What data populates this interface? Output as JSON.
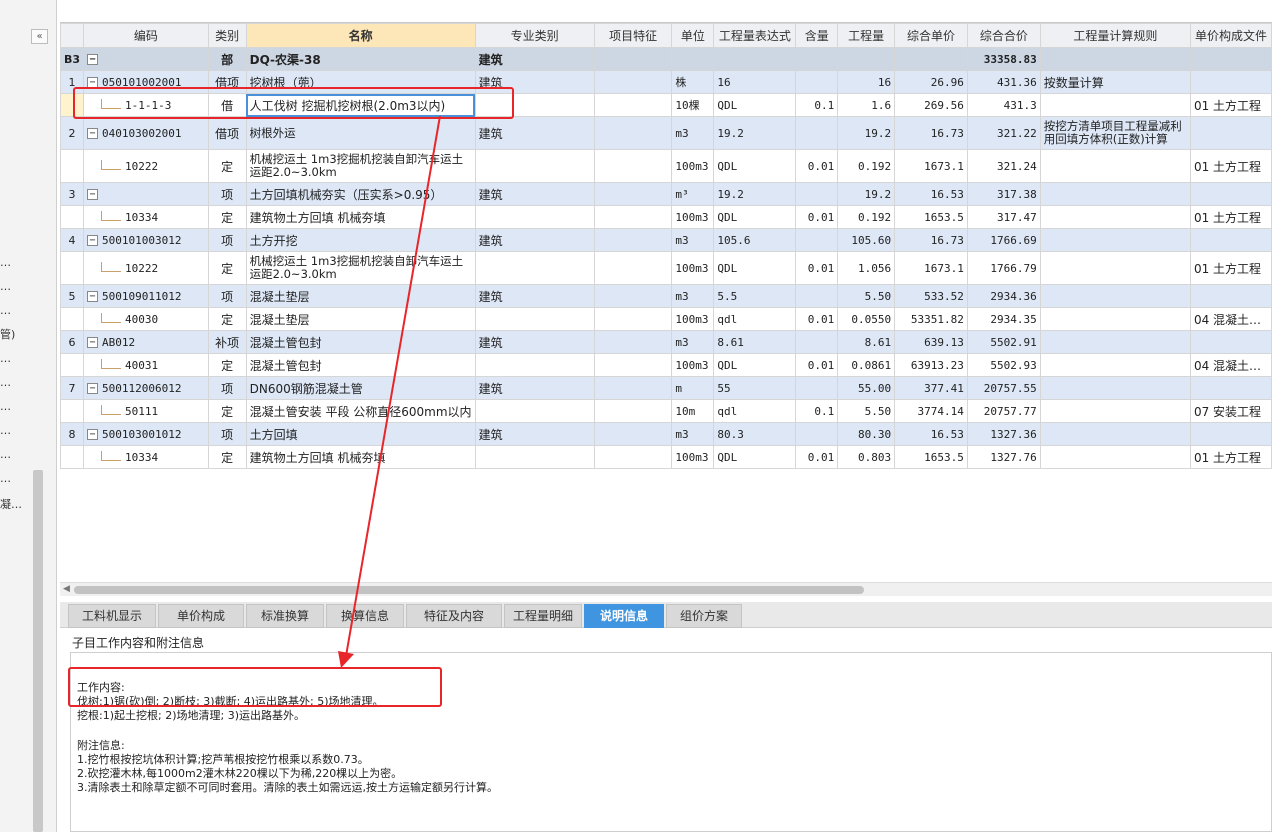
{
  "left_panel": {
    "collapse_label": "«",
    "items": [
      "…",
      "…",
      "…",
      "管)",
      "…",
      "…",
      "…",
      "…",
      "…",
      "…",
      "凝…"
    ]
  },
  "columns": [
    "",
    "编码",
    "类别",
    "名称",
    "专业类别",
    "项目特征",
    "单位",
    "工程量表达式",
    "含量",
    "工程量",
    "综合单价",
    "综合合价",
    "工程量计算规则",
    "单价构成文件"
  ],
  "rows": [
    {
      "type": "section",
      "no": "B3",
      "expand": "−",
      "code": "",
      "cat": "部",
      "name": "DQ-农渠-38",
      "major": "建筑",
      "feature": "",
      "unit": "",
      "expr": "",
      "content": "",
      "qty": "",
      "price": "",
      "total": "33358.83",
      "rule": "",
      "file": ""
    },
    {
      "type": "item",
      "no": "1",
      "expand": "−",
      "code": "050101002001",
      "cat": "借项",
      "name": "挖树根（蔸）",
      "major": "建筑",
      "feature": "",
      "unit": "株",
      "expr": "16",
      "content": "",
      "qty": "16",
      "price": "26.96",
      "total": "431.36",
      "rule": "按数量计算",
      "file": ""
    },
    {
      "type": "quota",
      "no": "",
      "code": "1-1-1-3",
      "cat": "借",
      "name": "人工伐树 挖掘机挖树根(2.0m3以内)",
      "major": "",
      "feature": "",
      "unit": "10棵",
      "expr": "QDL",
      "content": "0.1",
      "qty": "1.6",
      "price": "269.56",
      "total": "431.3",
      "rule": "",
      "file": "01 土方工程",
      "selected": true
    },
    {
      "type": "item",
      "no": "2",
      "expand": "−",
      "code": "040103002001",
      "cat": "借项",
      "name": "树根外运",
      "major": "建筑",
      "feature": "",
      "unit": "m3",
      "expr": "19.2",
      "content": "",
      "qty": "19.2",
      "price": "16.73",
      "total": "321.22",
      "rule": "按挖方清单项目工程量减利用回填方体积(正数)计算",
      "file": "",
      "tall": true
    },
    {
      "type": "quota",
      "no": "",
      "code": "10222",
      "cat": "定",
      "name": "机械挖运土 1m3挖掘机挖装自卸汽车运土 运距2.0~3.0km",
      "major": "",
      "feature": "",
      "unit": "100m3",
      "expr": "QDL",
      "content": "0.01",
      "qty": "0.192",
      "price": "1673.1",
      "total": "321.24",
      "rule": "",
      "file": "01 土方工程",
      "tall": true
    },
    {
      "type": "item",
      "no": "3",
      "expand": "−",
      "code": "",
      "cat": "项",
      "name": "土方回填机械夯实（压实系>0.95）",
      "major": "建筑",
      "feature": "",
      "unit": "m³",
      "expr": "19.2",
      "content": "",
      "qty": "19.2",
      "price": "16.53",
      "total": "317.38",
      "rule": "",
      "file": ""
    },
    {
      "type": "quota",
      "no": "",
      "code": "10334",
      "cat": "定",
      "name": "建筑物土方回填 机械夯填",
      "major": "",
      "feature": "",
      "unit": "100m3",
      "expr": "QDL",
      "content": "0.01",
      "qty": "0.192",
      "price": "1653.5",
      "total": "317.47",
      "rule": "",
      "file": "01 土方工程"
    },
    {
      "type": "item",
      "no": "4",
      "expand": "−",
      "code": "500101003012",
      "cat": "项",
      "name": "土方开挖",
      "major": "建筑",
      "feature": "",
      "unit": "m3",
      "expr": "105.6",
      "content": "",
      "qty": "105.60",
      "price": "16.73",
      "total": "1766.69",
      "rule": "",
      "file": ""
    },
    {
      "type": "quota",
      "no": "",
      "code": "10222",
      "cat": "定",
      "name": "机械挖运土 1m3挖掘机挖装自卸汽车运土 运距2.0~3.0km",
      "major": "",
      "feature": "",
      "unit": "100m3",
      "expr": "QDL",
      "content": "0.01",
      "qty": "1.056",
      "price": "1673.1",
      "total": "1766.79",
      "rule": "",
      "file": "01 土方工程",
      "tall": true
    },
    {
      "type": "item",
      "no": "5",
      "expand": "−",
      "code": "500109011012",
      "cat": "项",
      "name": "混凝土垫层",
      "major": "建筑",
      "feature": "",
      "unit": "m3",
      "expr": "5.5",
      "content": "",
      "qty": "5.50",
      "price": "533.52",
      "total": "2934.36",
      "rule": "",
      "file": ""
    },
    {
      "type": "quota",
      "no": "",
      "code": "40030",
      "cat": "定",
      "name": "混凝土垫层",
      "major": "",
      "feature": "",
      "unit": "100m3",
      "expr": "qdl",
      "content": "0.01",
      "qty": "0.0550",
      "price": "53351.82",
      "total": "2934.35",
      "rule": "",
      "file": "04 混凝土…"
    },
    {
      "type": "item",
      "no": "6",
      "expand": "−",
      "code": "AB012",
      "cat": "补项",
      "name": "混凝土管包封",
      "major": "建筑",
      "feature": "",
      "unit": "m3",
      "expr": "8.61",
      "content": "",
      "qty": "8.61",
      "price": "639.13",
      "total": "5502.91",
      "rule": "",
      "file": ""
    },
    {
      "type": "quota",
      "no": "",
      "code": "40031",
      "cat": "定",
      "name": "混凝土管包封",
      "major": "",
      "feature": "",
      "unit": "100m3",
      "expr": "QDL",
      "content": "0.01",
      "qty": "0.0861",
      "price": "63913.23",
      "total": "5502.93",
      "rule": "",
      "file": "04 混凝土…"
    },
    {
      "type": "item",
      "no": "7",
      "expand": "−",
      "code": "500112006012",
      "cat": "项",
      "name": "DN600钢筋混凝土管",
      "major": "建筑",
      "feature": "",
      "unit": "m",
      "expr": "55",
      "content": "",
      "qty": "55.00",
      "price": "377.41",
      "total": "20757.55",
      "rule": "",
      "file": ""
    },
    {
      "type": "quota",
      "no": "",
      "code": "50111",
      "cat": "定",
      "name": "混凝土管安装 平段 公称直径600mm以内",
      "major": "",
      "feature": "",
      "unit": "10m",
      "expr": "qdl",
      "content": "0.1",
      "qty": "5.50",
      "price": "3774.14",
      "total": "20757.77",
      "rule": "",
      "file": "07 安装工程"
    },
    {
      "type": "item",
      "no": "8",
      "expand": "−",
      "code": "500103001012",
      "cat": "项",
      "name": "土方回填",
      "major": "建筑",
      "feature": "",
      "unit": "m3",
      "expr": "80.3",
      "content": "",
      "qty": "80.30",
      "price": "16.53",
      "total": "1327.36",
      "rule": "",
      "file": ""
    },
    {
      "type": "quota",
      "no": "",
      "code": "10334",
      "cat": "定",
      "name": "建筑物土方回填 机械夯填",
      "major": "",
      "feature": "",
      "unit": "100m3",
      "expr": "QDL",
      "content": "0.01",
      "qty": "0.803",
      "price": "1653.5",
      "total": "1327.76",
      "rule": "",
      "file": "01 土方工程"
    }
  ],
  "tabs": [
    {
      "label": "工料机显示",
      "active": false
    },
    {
      "label": "单价构成",
      "active": false
    },
    {
      "label": "标准换算",
      "active": false
    },
    {
      "label": "换算信息",
      "active": false
    },
    {
      "label": "特征及内容",
      "active": false
    },
    {
      "label": "工程量明细",
      "active": false
    },
    {
      "label": "说明信息",
      "active": true
    },
    {
      "label": "组价方案",
      "active": false
    }
  ],
  "description": {
    "title": "子目工作内容和附注信息",
    "lines": [
      "工作内容:",
      "伐树:1)锯(砍)倒; 2)断枝; 3)截断; 4)运出路基外; 5)场地清理。",
      "挖根:1)起土挖根; 2)场地清理; 3)运出路基外。",
      "",
      "附注信息:",
      "1.挖竹根按挖坑体积计算;挖芦苇根按挖竹根乘以系数0.73。",
      "2.砍挖灌木林,每1000m2灌木林220棵以下为稀,220棵以上为密。",
      "3.清除表土和除草定额不可同时套用。清除的表土如需远运,按土方运输定额另行计算。"
    ]
  },
  "colors": {
    "annotation": "#e8262a",
    "active_tab": "#3f95e0",
    "section_row": "#cdd6e3",
    "item_row": "#dde7f6"
  }
}
